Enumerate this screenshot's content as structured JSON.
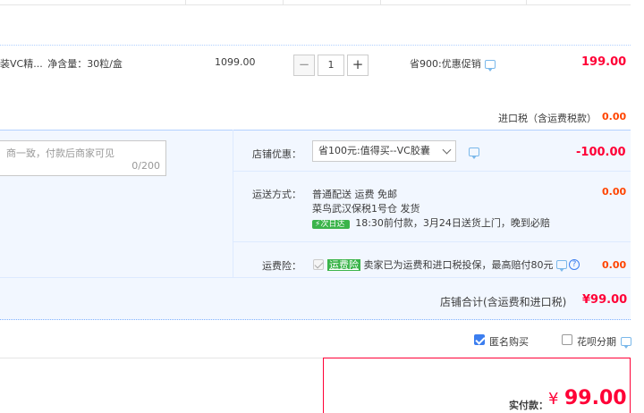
{
  "item": {
    "name": "装VC精...",
    "spec": "净含量：30粒/盒",
    "unit_price": "1099.00",
    "quantity": "1",
    "minus": "−",
    "plus": "+",
    "promo": "省900:优惠促销",
    "subtotal": "199.00"
  },
  "import_tax": {
    "label": "进口税（含运费税款）",
    "value": "0.00"
  },
  "message": {
    "placeholder": "商一致，付款后商家可见",
    "counter": "0/200"
  },
  "shop_discount": {
    "label": "店铺优惠：",
    "selected": "省100元:值得买--VC胶囊",
    "value": "-100.00"
  },
  "shipping": {
    "label": "运送方式：",
    "method": "普通配送 运费 免邮",
    "warehouse": "菜鸟武汉保税1号仓   发货",
    "badge": "次日达",
    "eta": "18:30前付款，3月24日送货上门，晚到必赔",
    "value": "0.00"
  },
  "insurance": {
    "label": "运费险：",
    "tag": "运费险",
    "text": "卖家已为运费和进口税投保，最高赔付80元",
    "value": "0.00",
    "help": "?"
  },
  "shop_total": {
    "label": "店铺合计(含运费和进口税)",
    "value": "¥99.00"
  },
  "options": {
    "anonymous": "匿名购买",
    "huabei": "花呗分期"
  },
  "payment": {
    "label": "实付款：",
    "currency": "¥",
    "amount": "99.00"
  },
  "colors": {
    "accent_red": "#ff0036",
    "blue": "#3c7eef",
    "green": "#3bb44a"
  }
}
